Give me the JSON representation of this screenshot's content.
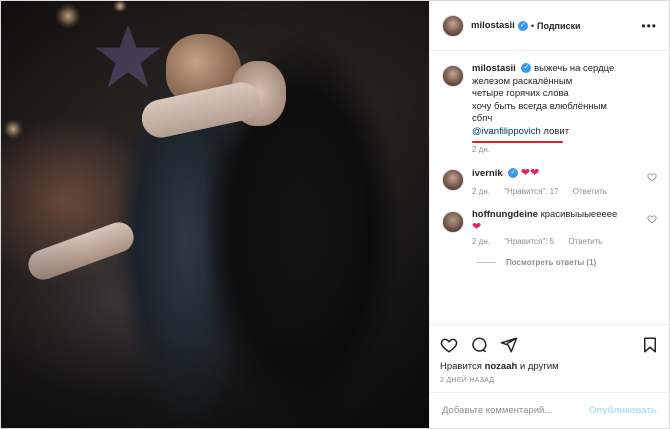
{
  "post": {
    "username": "milostasii",
    "verified": true,
    "follow_label": "Подписки",
    "more_label": "•••"
  },
  "caption": {
    "username": "milostasii",
    "lines": [
      "выжечь на сердце",
      "железом раскалённым",
      "четыре горячих слова",
      "хочу быть всегда влюблённым",
      "сбпч"
    ],
    "mention": "@ivanfilippovich",
    "mention_suffix": " ловит",
    "time": "2 дн.",
    "annotation_color": "#e02020"
  },
  "comments": [
    {
      "username": "ivernik",
      "verified": true,
      "text": "❤❤",
      "time": "2 дн.",
      "likes": "\"Нравится\": 17",
      "reply": "Ответить"
    },
    {
      "username": "hoffnungdeine",
      "verified": false,
      "text": "красивыыыеееее",
      "emoji": "❤",
      "time": "2 дн.",
      "likes": "\"Нравится\": 5",
      "reply": "Ответить"
    }
  ],
  "view_replies": "Посмотреть ответы (1)",
  "actions": {
    "like_icon": "heart-icon",
    "comment_icon": "comment-icon",
    "share_icon": "share-icon",
    "save_icon": "bookmark-icon"
  },
  "likes": {
    "prefix": "Нравится ",
    "user": "nozaah",
    "suffix": " и другим"
  },
  "date": "2 ДНЕЙ НАЗАД",
  "composer": {
    "placeholder": "Добавьте комментарий...",
    "post_label": "Опубликовать"
  },
  "colors": {
    "link": "#00376b",
    "verified": "#3897f0",
    "heart": "#e0245e",
    "post_disabled": "#b2dffc"
  }
}
